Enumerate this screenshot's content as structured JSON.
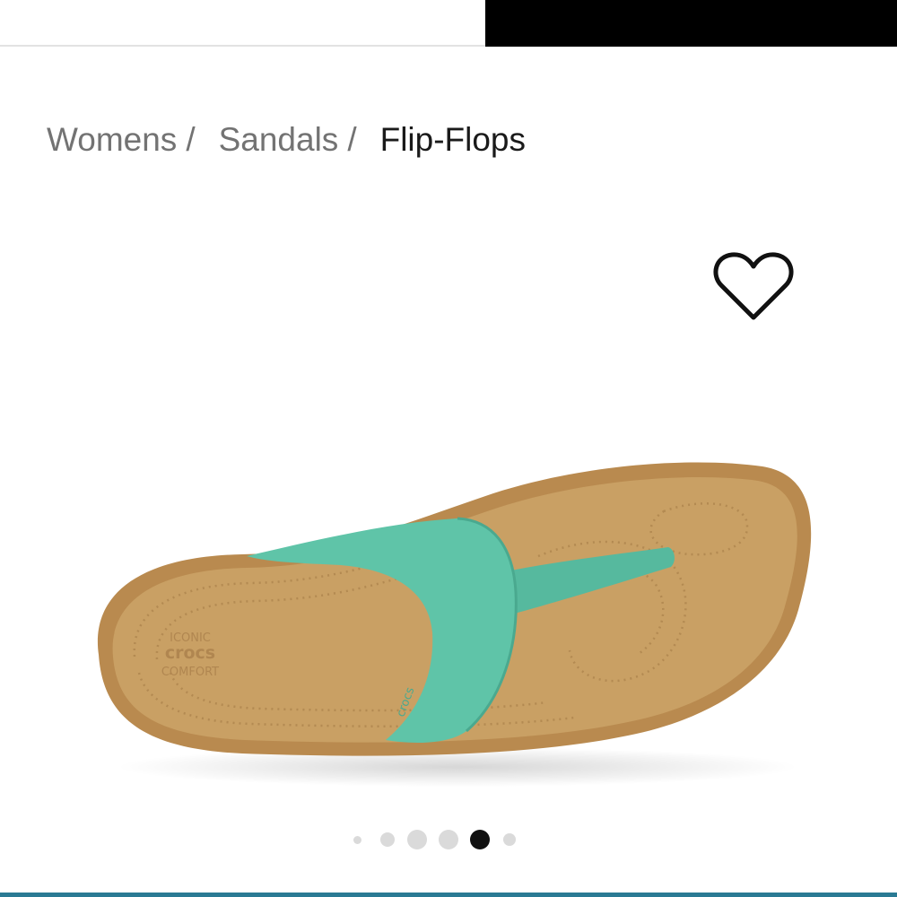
{
  "breadcrumb": {
    "items": [
      {
        "label": "Womens"
      },
      {
        "label": "Sandals"
      }
    ],
    "separator": "/",
    "current": "Flip-Flops"
  },
  "favorite": {
    "icon": "heart-outline-icon"
  },
  "product_image": {
    "alt_icon": "flip-flop-sandal-image",
    "footbed_text": [
      "ICONIC",
      "crocs",
      "COMFORT"
    ],
    "strap_text": "crocs",
    "strap_color": "#5fc4a8",
    "footbed_color": "#c9a064"
  },
  "carousel": {
    "total": 6,
    "active_index": 4
  },
  "colors": {
    "accent_strip": "#2a7a94"
  }
}
